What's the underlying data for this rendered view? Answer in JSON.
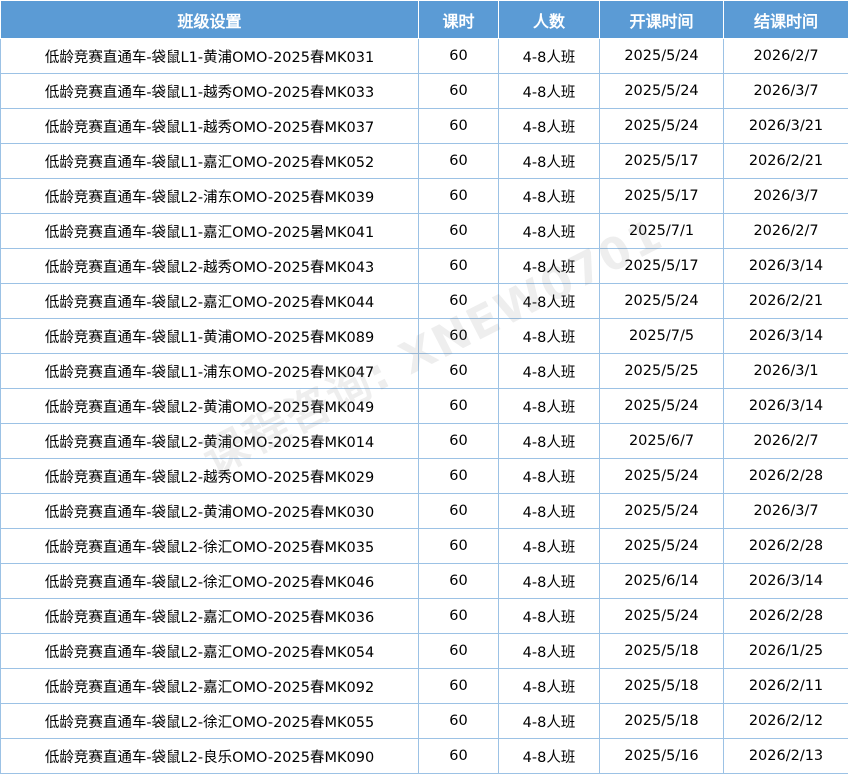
{
  "table": {
    "headers": [
      "班级设置",
      "课时",
      "人数",
      "开课时间",
      "结课时间"
    ],
    "rows": [
      [
        "低龄竞赛直通车-袋鼠L1-黄浦OMO-2025春MK031",
        "60",
        "4-8人班",
        "2025/5/24",
        "2026/2/7"
      ],
      [
        "低龄竞赛直通车-袋鼠L1-越秀OMO-2025春MK033",
        "60",
        "4-8人班",
        "2025/5/24",
        "2026/3/7"
      ],
      [
        "低龄竞赛直通车-袋鼠L1-越秀OMO-2025春MK037",
        "60",
        "4-8人班",
        "2025/5/24",
        "2026/3/21"
      ],
      [
        "低龄竞赛直通车-袋鼠L1-嘉汇OMO-2025春MK052",
        "60",
        "4-8人班",
        "2025/5/17",
        "2026/2/21"
      ],
      [
        "低龄竞赛直通车-袋鼠L2-浦东OMO-2025春MK039",
        "60",
        "4-8人班",
        "2025/5/17",
        "2026/3/7"
      ],
      [
        "低龄竞赛直通车-袋鼠L1-嘉汇OMO-2025暑MK041",
        "60",
        "4-8人班",
        "2025/7/1",
        "2026/2/7"
      ],
      [
        "低龄竞赛直通车-袋鼠L2-越秀OMO-2025春MK043",
        "60",
        "4-8人班",
        "2025/5/17",
        "2026/3/14"
      ],
      [
        "低龄竞赛直通车-袋鼠L2-嘉汇OMO-2025春MK044",
        "60",
        "4-8人班",
        "2025/5/24",
        "2026/2/21"
      ],
      [
        "低龄竞赛直通车-袋鼠L1-黄浦OMO-2025春MK089",
        "60",
        "4-8人班",
        "2025/7/5",
        "2026/3/14"
      ],
      [
        "低龄竞赛直通车-袋鼠L1-浦东OMO-2025春MK047",
        "60",
        "4-8人班",
        "2025/5/25",
        "2026/3/1"
      ],
      [
        "低龄竞赛直通车-袋鼠L2-黄浦OMO-2025春MK049",
        "60",
        "4-8人班",
        "2025/5/24",
        "2026/3/14"
      ],
      [
        "低龄竞赛直通车-袋鼠L2-黄浦OMO-2025春MK014",
        "60",
        "4-8人班",
        "2025/6/7",
        "2026/2/7"
      ],
      [
        "低龄竞赛直通车-袋鼠L2-越秀OMO-2025春MK029",
        "60",
        "4-8人班",
        "2025/5/24",
        "2026/2/28"
      ],
      [
        "低龄竞赛直通车-袋鼠L2-黄浦OMO-2025春MK030",
        "60",
        "4-8人班",
        "2025/5/24",
        "2026/3/7"
      ],
      [
        "低龄竞赛直通车-袋鼠L2-徐汇OMO-2025春MK035",
        "60",
        "4-8人班",
        "2025/5/24",
        "2026/2/28"
      ],
      [
        "低龄竞赛直通车-袋鼠L2-徐汇OMO-2025春MK046",
        "60",
        "4-8人班",
        "2025/6/14",
        "2026/3/14"
      ],
      [
        "低龄竞赛直通车-袋鼠L2-嘉汇OMO-2025春MK036",
        "60",
        "4-8人班",
        "2025/5/24",
        "2026/2/28"
      ],
      [
        "低龄竞赛直通车-袋鼠L2-嘉汇OMO-2025春MK054",
        "60",
        "4-8人班",
        "2025/5/18",
        "2026/1/25"
      ],
      [
        "低龄竞赛直通车-袋鼠L2-嘉汇OMO-2025春MK092",
        "60",
        "4-8人班",
        "2025/5/18",
        "2026/2/11"
      ],
      [
        "低龄竞赛直通车-袋鼠L2-徐汇OMO-2025春MK055",
        "60",
        "4-8人班",
        "2025/5/18",
        "2026/2/12"
      ],
      [
        "低龄竞赛直通车-袋鼠L2-良乐OMO-2025春MK090",
        "60",
        "4-8人班",
        "2025/5/16",
        "2026/2/13"
      ]
    ]
  },
  "watermark": {
    "text": "课程咨询: XNEW0701"
  },
  "colors": {
    "header_bg": "#5b9bd5",
    "header_text": "#ffffff",
    "grid_line": "#9cc2e5"
  }
}
